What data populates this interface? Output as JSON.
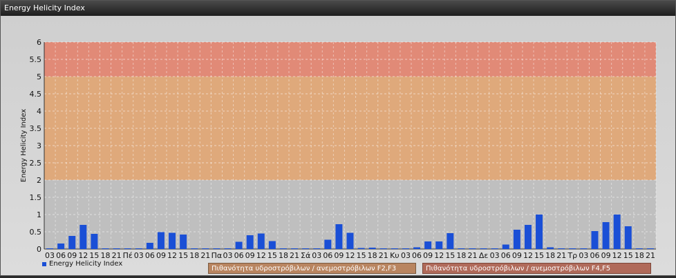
{
  "window": {
    "title": "Energy Helicity Index"
  },
  "legend": {
    "series_label": "Energy Helicity Index"
  },
  "bands": [
    {
      "label": "Πιθανότητα υδροστρόβιλων / ανεμοστρόβιλων F2,F3",
      "from": 2,
      "to": 5,
      "color": "#e4a46e"
    },
    {
      "label": "Πιθανότητα υδροστρόβιλων / ανεμοστρόβιλων F4,F5",
      "from": 5,
      "to": 6,
      "color": "#e6806a"
    }
  ],
  "chart_data": {
    "type": "bar",
    "ylabel": "Energy Helicity Index",
    "xlabel": "",
    "ylim": [
      0,
      6
    ],
    "yticks": [
      "0",
      "0.5",
      "1",
      "1.5",
      "2",
      "2.5",
      "3",
      "3.5",
      "4",
      "4.5",
      "5",
      "5.5",
      "6"
    ],
    "categories": [
      "03",
      "06",
      "09",
      "12",
      "15",
      "18",
      "21",
      "Πέ",
      "03",
      "06",
      "09",
      "12",
      "15",
      "18",
      "21",
      "Πα",
      "03",
      "06",
      "09",
      "12",
      "15",
      "18",
      "21",
      "Σά",
      "03",
      "06",
      "09",
      "12",
      "15",
      "18",
      "21",
      "Κυ",
      "03",
      "06",
      "09",
      "12",
      "15",
      "18",
      "21",
      "Δε",
      "03",
      "06",
      "09",
      "12",
      "15",
      "18",
      "21",
      "Τρ",
      "03",
      "06",
      "09",
      "12",
      "15",
      "18",
      "21"
    ],
    "series": [
      {
        "name": "Energy Helicity Index",
        "color": "#1a4fd6",
        "values": [
          0.02,
          0.16,
          0.38,
          0.7,
          0.44,
          0.02,
          0.02,
          0.02,
          0.02,
          0.18,
          0.49,
          0.47,
          0.42,
          0.02,
          0.02,
          0.02,
          0.02,
          0.21,
          0.4,
          0.45,
          0.23,
          0.02,
          0.02,
          0.02,
          0.02,
          0.27,
          0.72,
          0.47,
          0.03,
          0.04,
          0.02,
          0.02,
          0.02,
          0.05,
          0.22,
          0.22,
          0.46,
          0.02,
          0.02,
          0.02,
          0.02,
          0.13,
          0.56,
          0.7,
          1.0,
          0.05,
          0.02,
          0.02,
          0.02,
          0.52,
          0.78,
          1.0,
          0.66,
          0.02,
          0.02
        ]
      }
    ]
  }
}
